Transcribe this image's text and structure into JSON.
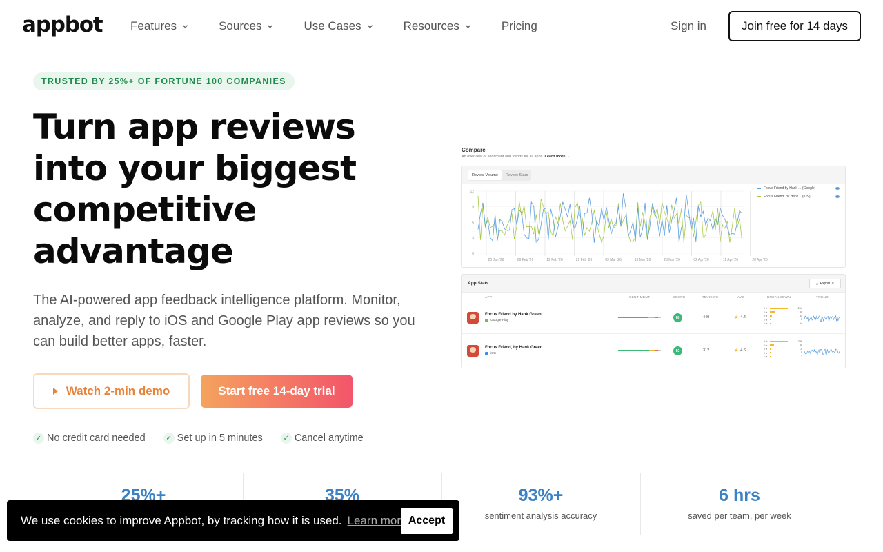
{
  "nav": {
    "logo": "appbot",
    "items": [
      {
        "label": "Features",
        "dropdown": true
      },
      {
        "label": "Sources",
        "dropdown": true
      },
      {
        "label": "Use Cases",
        "dropdown": true
      },
      {
        "label": "Resources",
        "dropdown": true
      },
      {
        "label": "Pricing",
        "dropdown": false
      }
    ],
    "signin": "Sign in",
    "join": "Join free for 14 days"
  },
  "hero": {
    "badge": "TRUSTED BY 25%+ OF FORTUNE 100 COMPANIES",
    "headline": "Turn app reviews into your biggest competitive advantage",
    "subtext": "The AI-powered app feedback intelligence platform. Monitor, analyze, and reply to iOS and Google Play app reviews so you can build better apps, faster.",
    "demo_button": "Watch 2-min demo",
    "trial_button": "Start free 14-day trial",
    "checks": [
      "No credit card needed",
      "Set up in 5 minutes",
      "Cancel anytime"
    ]
  },
  "dashboard": {
    "compare_title": "Compare",
    "compare_sub": "An overview of sentiment and trends for all apps.",
    "learn_more": "Learn more →",
    "tabs": [
      "Review Volume",
      "Review Stars"
    ],
    "y_ticks": [
      "12",
      "9",
      "6",
      "3",
      "0"
    ],
    "x_ticks": [
      "26 Jan '26",
      "09 Feb '26",
      "12 Feb '26",
      "21 Feb '26",
      "03 Mar '26",
      "13 Mar '26",
      "23 Mar '26",
      "02 Apr '26",
      "11 Apr '26",
      "20 Apr '26"
    ],
    "legend": [
      "Focus Friend by Hank ... (Google)",
      "Focus Friend, by Hank... (iOS)"
    ],
    "series_colors": {
      "google": "#5a9fe0",
      "ios": "#a9c94a"
    },
    "app_stats_title": "App Stats",
    "export_label": "Export",
    "columns": [
      "APP",
      "SENTIMENT",
      "SCORE",
      "REVIEWS",
      "AVG",
      "BREAKDOWN",
      "TREND"
    ],
    "rows": [
      {
        "name": "Focus Friend by Hank Green",
        "store": "Google Play",
        "score": "88",
        "reviews": "440",
        "avg": "4.4",
        "breakdown": [
          {
            "label": "5",
            "count": "294",
            "frac": 0.9
          },
          {
            "label": "4",
            "count": "64",
            "frac": 0.22
          },
          {
            "label": "3",
            "count": "31",
            "frac": 0.11
          },
          {
            "label": "2",
            "count": "7",
            "frac": 0.03
          },
          {
            "label": "1",
            "count": "24",
            "frac": 0.08
          }
        ]
      },
      {
        "name": "Focus Friend, by Hank Green",
        "store": "iOS",
        "score": "92",
        "reviews": "312",
        "avg": "4.6",
        "breakdown": [
          {
            "label": "5",
            "count": "236",
            "frac": 0.9
          },
          {
            "label": "4",
            "count": "50",
            "frac": 0.2
          },
          {
            "label": "3",
            "count": "14",
            "frac": 0.06
          },
          {
            "label": "2",
            "count": "5",
            "frac": 0.02
          },
          {
            "label": "1",
            "count": "7",
            "frac": 0.03
          }
        ]
      }
    ]
  },
  "stats": [
    {
      "num": "25%+",
      "label": ""
    },
    {
      "num": "35%",
      "label": ""
    },
    {
      "num": "93%+",
      "label": "sentiment analysis accuracy"
    },
    {
      "num": "6 hrs",
      "label": "saved per team, per week"
    }
  ],
  "cookie": {
    "text": "We use cookies to improve Appbot, by tracking how it is used.",
    "learn_more": "Learn more",
    "accept": "Accept"
  }
}
